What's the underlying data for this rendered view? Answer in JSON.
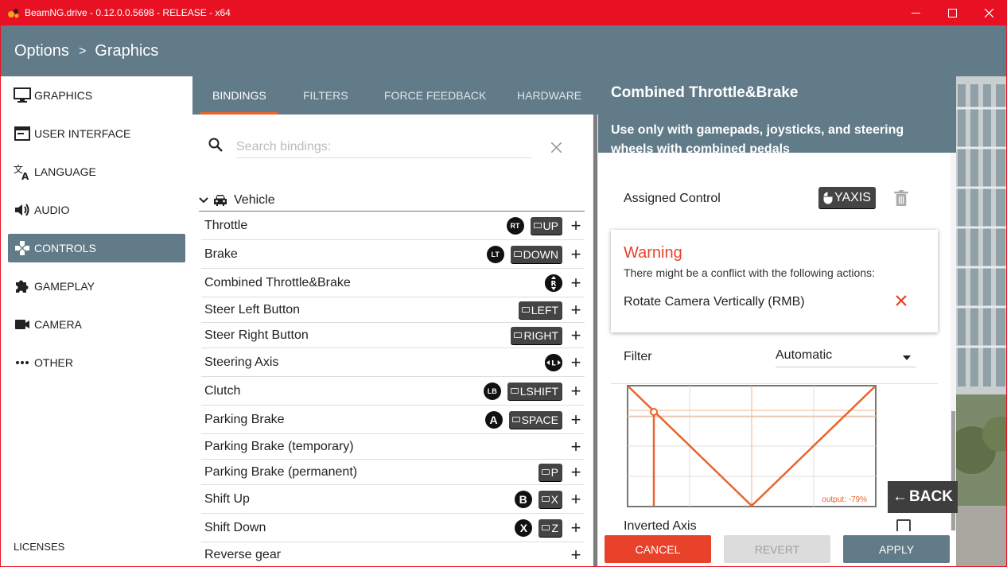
{
  "window": {
    "title": "BeamNG.drive - 0.12.0.0.5698 - RELEASE - x64",
    "controls": {
      "minimize": "─",
      "maximize": "☐",
      "close": "✕"
    },
    "accent": "#e81123"
  },
  "breadcrumb": {
    "root": "Options",
    "separator": ">",
    "current": "Graphics"
  },
  "sidebar": {
    "items": [
      {
        "label": "GRAPHICS",
        "icon": "monitor-icon"
      },
      {
        "label": "USER INTERFACE",
        "icon": "window-icon"
      },
      {
        "label": "LANGUAGE",
        "icon": "translate-icon"
      },
      {
        "label": "AUDIO",
        "icon": "speaker-icon"
      },
      {
        "label": "CONTROLS",
        "icon": "gamepad-icon",
        "active": true
      },
      {
        "label": "GAMEPLAY",
        "icon": "puzzle-icon"
      },
      {
        "label": "CAMERA",
        "icon": "camera-icon"
      },
      {
        "label": "OTHER",
        "icon": "ellipsis-icon"
      }
    ],
    "licenses": "LICENSES"
  },
  "tabs": [
    {
      "label": "BINDINGS",
      "active": true
    },
    {
      "label": "FILTERS"
    },
    {
      "label": "FORCE FEEDBACK"
    },
    {
      "label": "HARDWARE"
    }
  ],
  "search": {
    "placeholder": "Search bindings:",
    "value": ""
  },
  "category": {
    "label": "Vehicle",
    "icon": "car-icon"
  },
  "bindings": [
    {
      "label": "Throttle",
      "badge": "RT",
      "key": "UP"
    },
    {
      "label": "Brake",
      "badge": "LT",
      "key": "DOWN"
    },
    {
      "label": "Combined Throttle&Brake",
      "badge": "R"
    },
    {
      "label": "Steer Left Button",
      "key": "LEFT"
    },
    {
      "label": "Steer Right Button",
      "key": "RIGHT"
    },
    {
      "label": "Steering Axis",
      "badge": "L"
    },
    {
      "label": "Clutch",
      "badge": "LB",
      "key": "LSHIFT"
    },
    {
      "label": "Parking Brake",
      "badge": "A",
      "key": "SPACE"
    },
    {
      "label": "Parking Brake (temporary)"
    },
    {
      "label": "Parking Brake (permanent)",
      "key": "P"
    },
    {
      "label": "Shift Up",
      "badge": "B",
      "key": "X"
    },
    {
      "label": "Shift Down",
      "badge": "X",
      "key": "Z"
    },
    {
      "label": "Reverse gear"
    }
  ],
  "detail": {
    "title": "Combined Throttle&Brake",
    "subtitle": "Use only with gamepads, joysticks, and steering wheels with combined pedals",
    "assigned_label": "Assigned Control",
    "assigned_value": "YAXIS",
    "warning": {
      "title": "Warning",
      "description": "There might be a conflict with the following actions:",
      "action": "Rotate Camera Vertically (RMB)"
    },
    "filter_label": "Filter",
    "filter_value": "Automatic",
    "graph_output": "output: -79%",
    "inverted_label": "Inverted Axis"
  },
  "footer": {
    "cancel": "CANCEL",
    "revert": "REVERT",
    "apply": "APPLY"
  },
  "back": "BACK",
  "colors": {
    "header": "#617b88",
    "accent_orange": "#e8642a",
    "cancel": "#e8432a",
    "revert": "#dcdcdc",
    "apply": "#617b88"
  }
}
